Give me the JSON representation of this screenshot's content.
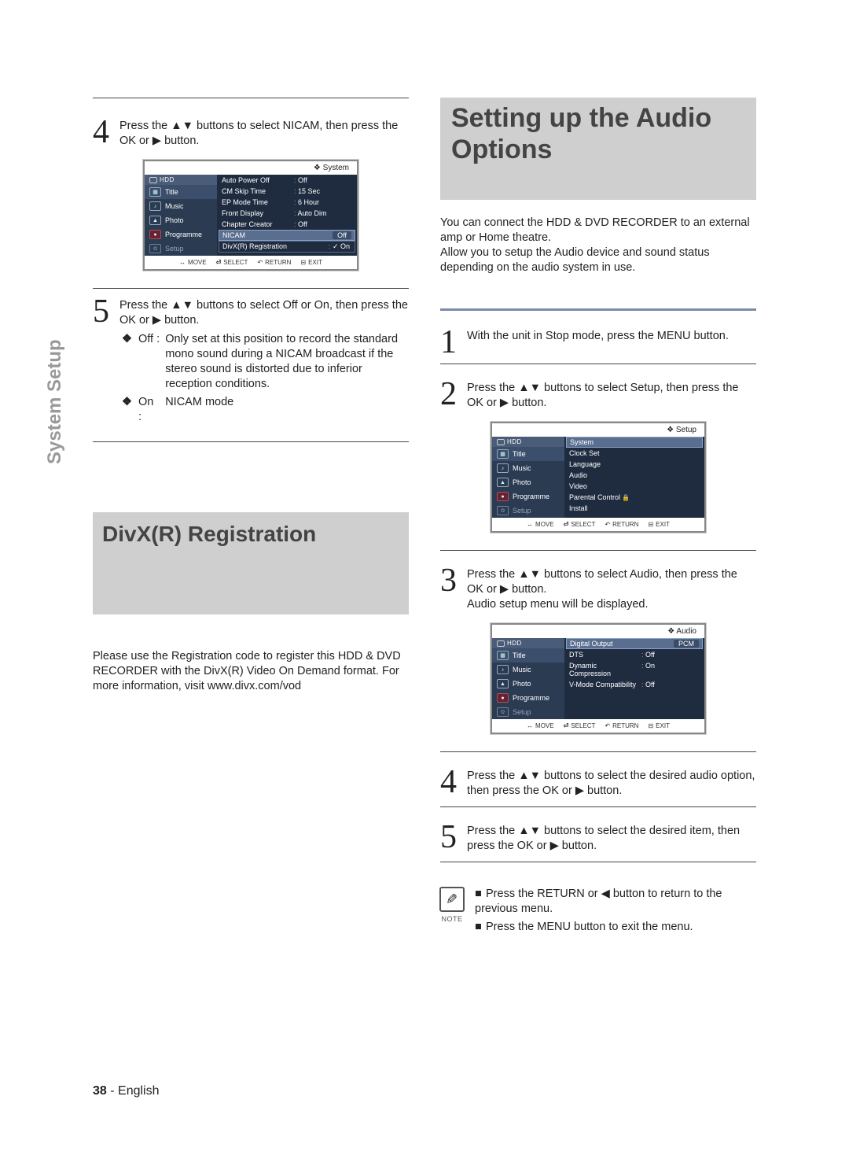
{
  "side_tab": "System Setup",
  "page_footer": {
    "num": "38",
    "sep": " - ",
    "lang": "English"
  },
  "left": {
    "step4": {
      "num": "4",
      "body": "Press the ▲▼ buttons to select NICAM, then press the OK or ▶ button."
    },
    "osd1": {
      "crumb": "System",
      "hdd": "HDD",
      "menu": [
        {
          "label": "Title"
        },
        {
          "label": "Music"
        },
        {
          "label": "Photo"
        },
        {
          "label": "Programme"
        },
        {
          "label": "Setup"
        }
      ],
      "rows": [
        {
          "lab": "Auto Power Off",
          "val": "Off"
        },
        {
          "lab": "CM Skip Time",
          "val": "15 Sec"
        },
        {
          "lab": "EP Mode Time",
          "val": "6 Hour"
        },
        {
          "lab": "Front Display",
          "val": "Auto Dim"
        },
        {
          "lab": "Chapter Creator",
          "val": "Off"
        }
      ],
      "hi": {
        "lab": "NICAM",
        "val": "Off"
      },
      "boxed": {
        "lab": "DivX(R) Registration",
        "val": "✓ On"
      },
      "foot": {
        "move": "MOVE",
        "select": "SELECT",
        "ret": "RETURN",
        "exit": "EXIT"
      }
    },
    "step5": {
      "num": "5",
      "body": "Press the ▲▼ buttons to select Off or On, then press the OK or ▶ button.",
      "off_label": "Off :",
      "off_text": "Only set at this position to record the standard mono sound during a NICAM broadcast if the stereo sound is distorted due to inferior reception conditions.",
      "on_label": "On :",
      "on_text": "NICAM mode"
    },
    "section_divx": "DivX(R) Registration",
    "divx_para": "Please use the Registration code to register this HDD & DVD RECORDER with the DivX(R) Video On Demand format. For more information, visit www.divx.com/vod"
  },
  "right": {
    "section_audio": "Setting up the Audio Options",
    "intro": "You can connect the HDD & DVD RECORDER to an external amp or Home theatre.\nAllow you to setup the Audio device and sound status depending on the audio system in use.",
    "step1": {
      "num": "1",
      "body": "With the unit in Stop mode, press the MENU button."
    },
    "step2": {
      "num": "2",
      "body": "Press the ▲▼ buttons to select Setup, then press the OK or ▶ button."
    },
    "osd2": {
      "crumb": "Setup",
      "hdd": "HDD",
      "menu": [
        {
          "label": "Title"
        },
        {
          "label": "Music"
        },
        {
          "label": "Photo"
        },
        {
          "label": "Programme"
        },
        {
          "label": "Setup"
        }
      ],
      "hi": {
        "lab": "System"
      },
      "rows": [
        {
          "lab": "Clock Set"
        },
        {
          "lab": "Language"
        },
        {
          "lab": "Audio"
        },
        {
          "lab": "Video"
        },
        {
          "lab": "Parental Control",
          "lock": true
        },
        {
          "lab": "Install"
        }
      ],
      "foot": {
        "move": "MOVE",
        "select": "SELECT",
        "ret": "RETURN",
        "exit": "EXIT"
      }
    },
    "step3": {
      "num": "3",
      "body": "Press the ▲▼ buttons to select Audio, then press the OK or ▶ button.\nAudio setup menu will be displayed."
    },
    "osd3": {
      "crumb": "Audio",
      "hdd": "HDD",
      "menu": [
        {
          "label": "Title"
        },
        {
          "label": "Music"
        },
        {
          "label": "Photo"
        },
        {
          "label": "Programme"
        },
        {
          "label": "Setup"
        }
      ],
      "hi": {
        "lab": "Digital Output",
        "val": "PCM"
      },
      "rows": [
        {
          "lab": "DTS",
          "val": "Off"
        },
        {
          "lab": "Dynamic Compression",
          "val": "On"
        },
        {
          "lab": "V-Mode Compatibility",
          "val": "Off"
        }
      ],
      "foot": {
        "move": "MOVE",
        "select": "SELECT",
        "ret": "RETURN",
        "exit": "EXIT"
      }
    },
    "step4": {
      "num": "4",
      "body": "Press the ▲▼ buttons to select the desired audio option, then press the OK or ▶ button."
    },
    "step5": {
      "num": "5",
      "body": "Press the ▲▼ buttons to select the desired item, then press the OK or ▶ button."
    },
    "note_label": "NOTE",
    "note_l1": "Press the RETURN or ◀ button to return to the previous menu.",
    "note_l2": "Press the MENU button to exit the menu."
  }
}
